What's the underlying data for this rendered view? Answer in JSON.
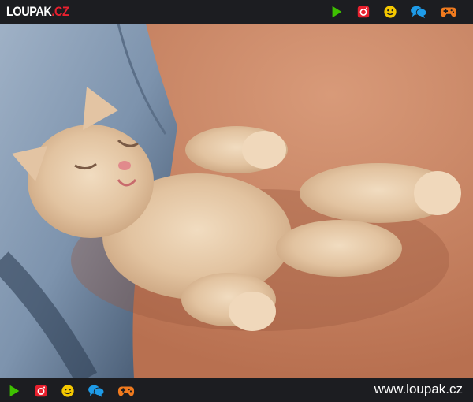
{
  "brand": {
    "logo_main": "LOUPAK",
    "logo_tld": ".CZ",
    "site_url": "www.loupak.cz"
  },
  "colors": {
    "bar_bg": "#1c1d21",
    "accent_red": "#e8202e",
    "play_green": "#3ec000",
    "instagram_red": "#e8202e",
    "smiley_yellow": "#f5c800",
    "chat_blue": "#1e9be8",
    "gamepad_orange": "#f07a1e"
  },
  "top_icons": [
    "play-icon",
    "instagram-icon",
    "smiley-icon",
    "chat-icon",
    "gamepad-icon"
  ],
  "bottom_icons": [
    "play-icon",
    "instagram-icon",
    "smiley-icon",
    "chat-icon",
    "gamepad-icon"
  ]
}
